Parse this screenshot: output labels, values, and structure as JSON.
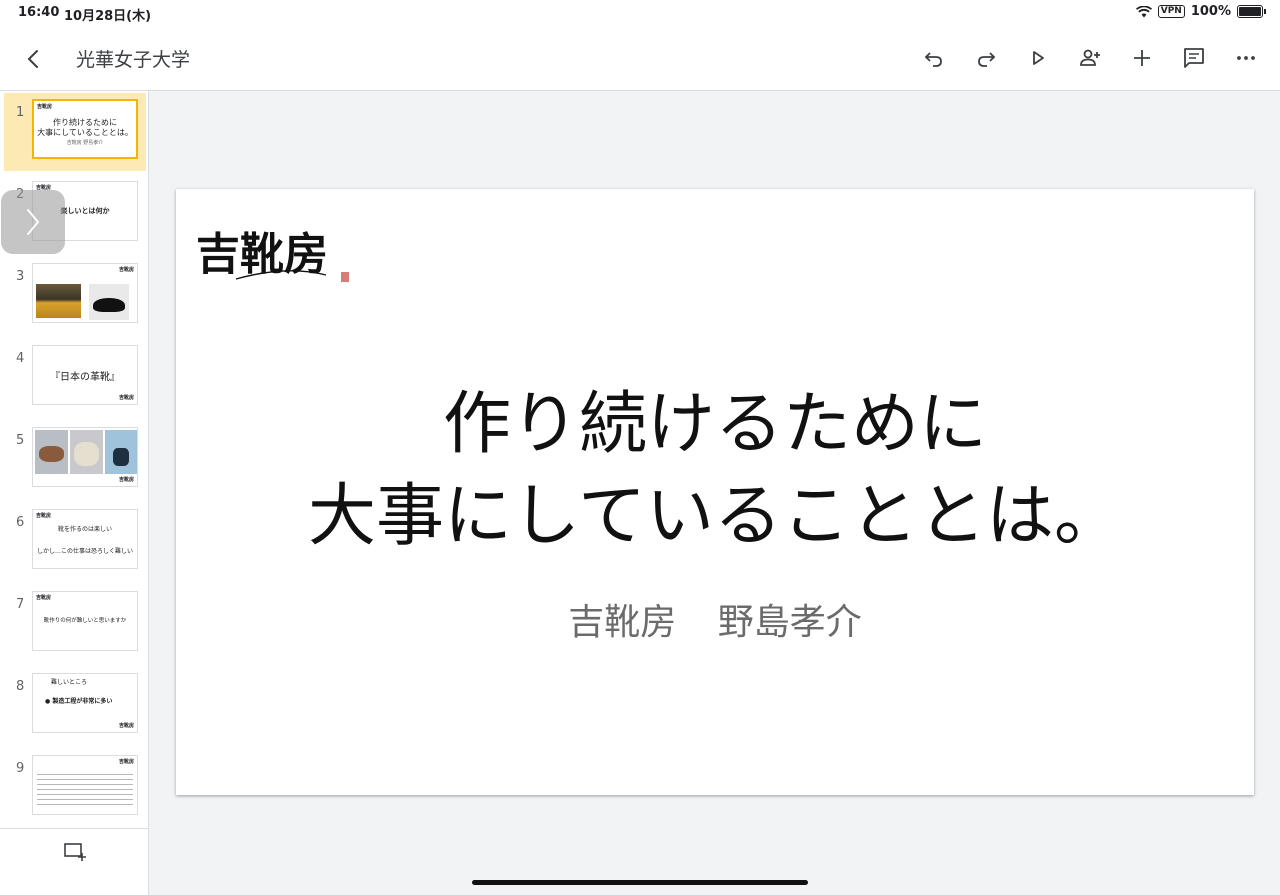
{
  "status_bar": {
    "time": "16:40",
    "date": "10月28日(木)",
    "vpn": "VPN",
    "battery": "100%"
  },
  "header": {
    "title": "光華女子大学"
  },
  "toolbar": {
    "buttons": [
      {
        "name": "undo-icon"
      },
      {
        "name": "redo-icon"
      },
      {
        "name": "play-icon"
      },
      {
        "name": "add-person-icon"
      },
      {
        "name": "plus-icon"
      },
      {
        "name": "comment-icon"
      },
      {
        "name": "more-icon"
      }
    ]
  },
  "slides": [
    {
      "num": "1",
      "logo": "吉靴房",
      "lines": [
        "作り続けるために",
        "大事にしていることとは。"
      ],
      "sub": "吉靴房 野島孝介"
    },
    {
      "num": "2",
      "logo": "吉靴房",
      "lines": [
        "楽しいとは何か"
      ]
    },
    {
      "num": "3",
      "logo": "吉靴房"
    },
    {
      "num": "4",
      "logo": "吉靴房",
      "lines": [
        "『日本の革靴』"
      ]
    },
    {
      "num": "5",
      "logo": "吉靴房"
    },
    {
      "num": "6",
      "logo": "吉靴房",
      "lines": [
        "靴を作るのは楽しい",
        "しかし…この仕事は恐ろしく難しい"
      ]
    },
    {
      "num": "7",
      "logo": "吉靴房",
      "lines": [
        "靴作りの何が難しいと思いますか"
      ]
    },
    {
      "num": "8",
      "logo": "吉靴房",
      "lines": [
        "難しいところ",
        "● 製造工程が非常に多い"
      ]
    },
    {
      "num": "9",
      "logo": "吉靴房"
    }
  ],
  "main_slide": {
    "logo": "吉靴房",
    "title_line1": "作り続けるために",
    "title_line2": "大事にしていることとは。",
    "subtitle": "吉靴房 野島孝介"
  },
  "colors": {
    "selected_bg": "#fde9b4",
    "selected_border": "#f4b400",
    "canvas_bg": "#f1f3f4"
  }
}
